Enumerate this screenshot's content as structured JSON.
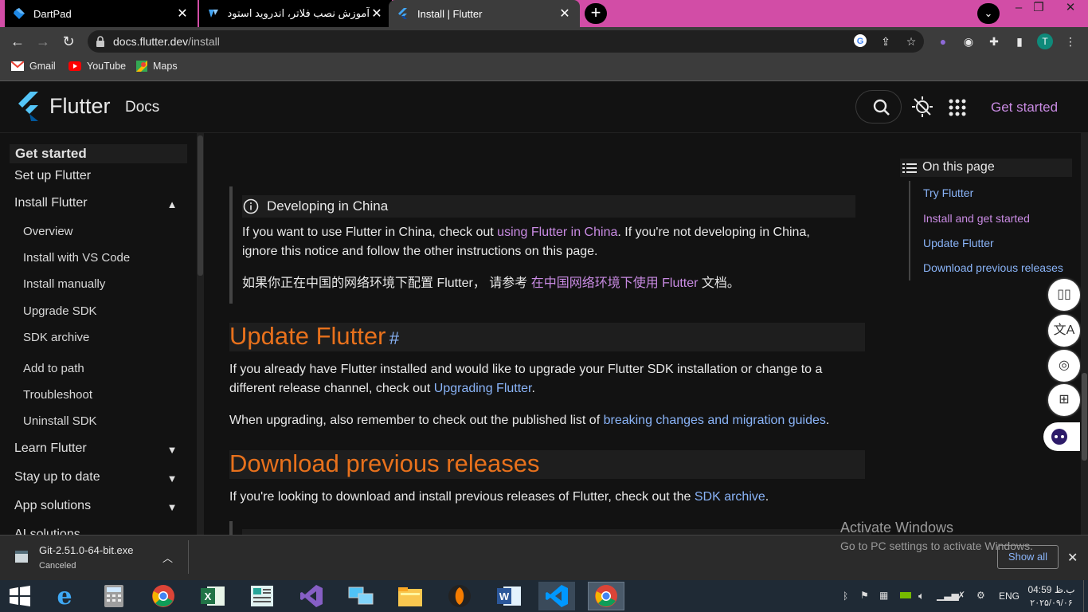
{
  "browser": {
    "tabs": [
      {
        "title": "DartPad",
        "state": "inactive"
      },
      {
        "title": "آموزش نصب فلاتر، اندروید استودیو",
        "state": "inactive"
      },
      {
        "title": "Install | Flutter",
        "state": "active"
      }
    ],
    "new_tab_symbol": "+",
    "url_host": "docs.flutter.dev",
    "url_path": "/install",
    "profile_initial": "T",
    "bookmarks": [
      "Gmail",
      "YouTube",
      "Maps"
    ]
  },
  "site_header": {
    "brand": "Flutter",
    "brand_suffix": "Docs",
    "cta": "Get started"
  },
  "sidebar": {
    "section_title": "Get started",
    "items": [
      {
        "label": "Set up Flutter"
      },
      {
        "label": "Install Flutter",
        "expanded": true
      },
      {
        "label": "Overview"
      },
      {
        "label": "Install with VS Code"
      },
      {
        "label": "Install manually"
      },
      {
        "label": "Upgrade SDK"
      },
      {
        "label": "SDK archive"
      },
      {
        "label": "Add to path"
      },
      {
        "label": "Troubleshoot"
      },
      {
        "label": "Uninstall SDK"
      },
      {
        "label": "Learn Flutter"
      },
      {
        "label": "Stay up to date"
      },
      {
        "label": "App solutions"
      },
      {
        "label": "AI solutions"
      }
    ]
  },
  "main": {
    "notice": {
      "title": "Developing in China",
      "p1_a": "If you want to use Flutter in China, check out ",
      "p1_link": "using Flutter in China",
      "p1_b": ". If you're not developing in China,",
      "p1_c": "ignore this notice and follow the other instructions on this page.",
      "p2_a": "如果你正在中国的网络环境下配置 Flutter， 请参考 ",
      "p2_link": "在中国网络环境下使用 Flutter",
      "p2_b": " 文档。"
    },
    "update": {
      "heading": "Update Flutter",
      "anchor": "#",
      "p1_a": "If you already have Flutter installed and would like to upgrade your Flutter SDK installation or change to a",
      "p1_b": "different release channel, check out ",
      "p1_link": "Upgrading Flutter",
      "p1_end": ".",
      "p2_a": "When upgrading, also remember to check out the published list of ",
      "p2_link": "breaking changes and migration guides",
      "p2_end": "."
    },
    "download": {
      "heading": "Download previous releases",
      "p1_a": "If you're looking to download and install previous releases of Flutter, check out the ",
      "p1_link": "SDK archive",
      "p1_end": "."
    }
  },
  "on_this_page": {
    "title": "On this page",
    "items": [
      "Try Flutter",
      "Install and get started",
      "Update Flutter",
      "Download previous releases"
    ]
  },
  "watermark": {
    "line1": "Activate Windows",
    "line2": "Go to PC settings to activate Windows."
  },
  "download_bar": {
    "filename": "Git-2.51.0-64-bit.exe",
    "status": "Canceled",
    "show_all": "Show all"
  },
  "taskbar": {
    "lang": "ENG",
    "time": "04:59 ب.ظ",
    "date": "۲۰۲۵/۰۹/۰۶"
  },
  "colors": {
    "accent_purple": "#c98be3",
    "heading_orange": "#e8711c",
    "link_blue": "#8ab4f8",
    "tab_strip": "#d24da6"
  }
}
